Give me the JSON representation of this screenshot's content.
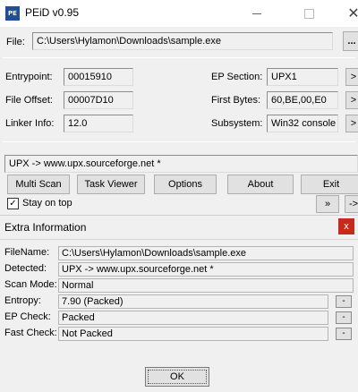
{
  "window": {
    "app_icon_text": "PE",
    "title": "PEiD v0.95",
    "close_glyph": "✕"
  },
  "file": {
    "label": "File:",
    "path": "C:\\Users\\Hylamon\\Downloads\\sample.exe",
    "browse_label": "..."
  },
  "info": {
    "entrypoint_label": "Entrypoint:",
    "entrypoint_value": "00015910",
    "file_offset_label": "File Offset:",
    "file_offset_value": "00007D10",
    "linker_info_label": "Linker Info:",
    "linker_info_value": "12.0",
    "ep_section_label": "EP Section:",
    "ep_section_value": "UPX1",
    "first_bytes_label": "First Bytes:",
    "first_bytes_value": "60,BE,00,E0",
    "subsystem_label": "Subsystem:",
    "subsystem_value": "Win32 console",
    "more_glyph": ">"
  },
  "detection": {
    "result": "UPX -> www.upx.sourceforge.net *"
  },
  "buttons": {
    "multi_scan": "Multi Scan",
    "task_viewer": "Task Viewer",
    "options": "Options",
    "about": "About",
    "exit": "Exit",
    "forward": "»",
    "arrow": "->"
  },
  "stay_on_top": {
    "label": "Stay on top",
    "checked": true,
    "check_glyph": "✓"
  },
  "extra_info": {
    "title": "Extra Information",
    "close_glyph": "x",
    "filename_label": "FileName:",
    "filename_value": "C:\\Users\\Hylamon\\Downloads\\sample.exe",
    "detected_label": "Detected:",
    "detected_value": "UPX -> www.upx.sourceforge.net *",
    "scan_mode_label": "Scan Mode:",
    "scan_mode_value": "Normal",
    "entropy_label": "Entropy:",
    "entropy_value": "7.90 (Packed)",
    "ep_check_label": "EP Check:",
    "ep_check_value": "Packed",
    "fast_check_label": "Fast Check:",
    "fast_check_value": "Not Packed",
    "small_btn_glyph": "-",
    "ok_label": "OK"
  }
}
